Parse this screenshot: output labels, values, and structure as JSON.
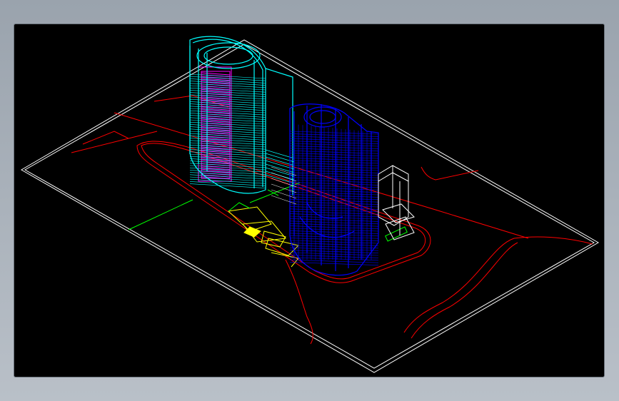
{
  "window": {
    "background_gradient": [
      "#9aa3ad",
      "#b9c0c8"
    ],
    "viewport_background": "#000000"
  },
  "drawing": {
    "description_text": "",
    "entities": {
      "site_boundary": {
        "color": "#ffffff"
      },
      "road_lines": {
        "color": "#ff0000"
      },
      "tower_a": {
        "color_outline": "#00ffff",
        "color_fill": "#ff00ff"
      },
      "tower_b": {
        "color": "#0000ff"
      },
      "small_block": {
        "color": "#ffffff"
      },
      "landscape": {
        "color_yellow": "#ffff00",
        "color_green": "#00ff00"
      },
      "annotation_text": ""
    }
  }
}
